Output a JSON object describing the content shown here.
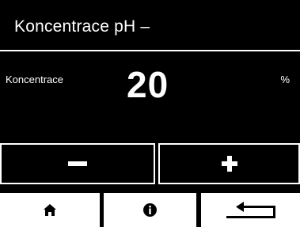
{
  "header": {
    "title": "Koncentrace pH –"
  },
  "reading": {
    "label": "Koncentrace",
    "value": "20",
    "unit": "%"
  },
  "controls": {
    "minus_icon": "minus-icon",
    "plus_icon": "plus-icon"
  },
  "nav": {
    "home_icon": "home-icon",
    "info_icon": "info-icon",
    "back_icon": "return-arrow-icon"
  }
}
